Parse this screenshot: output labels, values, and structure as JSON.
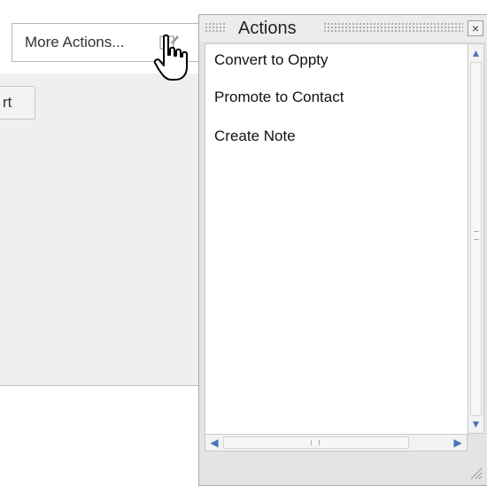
{
  "toolbar": {
    "more_actions_label": "More Actions...",
    "partial_button_label": "rt"
  },
  "actions_window": {
    "title": "Actions",
    "close_glyph": "×",
    "items": [
      {
        "label": "Convert to Oppty"
      },
      {
        "label": "Promote to Contact"
      },
      {
        "label": "Create Note"
      }
    ]
  },
  "icons": {
    "more_actions": "edit-icon",
    "cursor": "hand-pointer-icon",
    "scroll_up": "▲",
    "scroll_down": "▼",
    "scroll_left": "◀",
    "scroll_right": "▶"
  },
  "colors": {
    "scroll_arrow": "#4a72b8",
    "window_bg": "#e4e4e4"
  }
}
